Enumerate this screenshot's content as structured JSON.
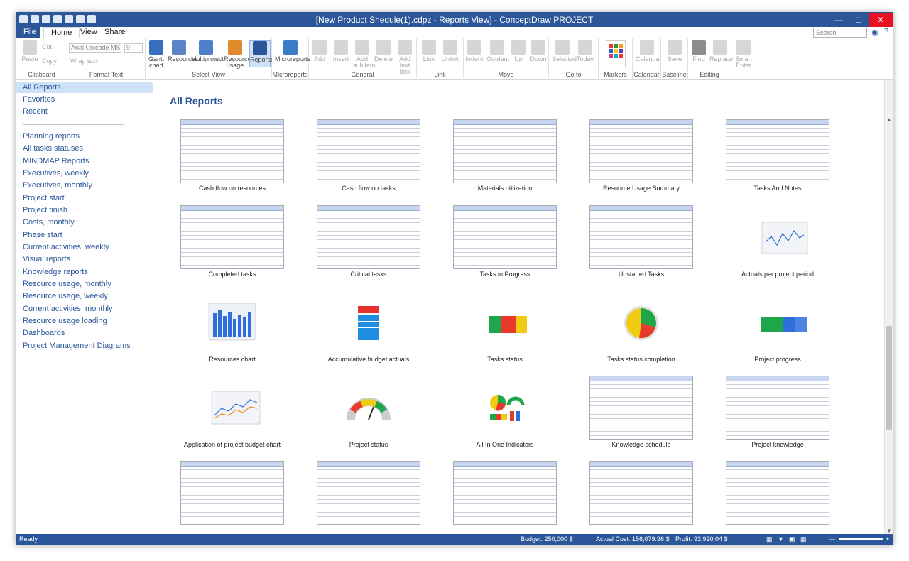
{
  "window": {
    "title": "[New Product Shedule(1).cdpz - Reports View] - ConceptDraw PROJECT"
  },
  "tabs": {
    "file": "File",
    "home": "Home",
    "view": "View",
    "share": "Share"
  },
  "search": {
    "placeholder": "Search"
  },
  "ribbon": {
    "clipboard": {
      "label": "Clipboard",
      "paste": "Paste",
      "cut": "Cut",
      "copy": "Copy"
    },
    "format_text": {
      "label": "Format Text",
      "font": "Arial Unicode MS",
      "size": "9",
      "wrap": "Wrap text"
    },
    "select_view": {
      "label": "Select View",
      "gantt": "Gantt chart",
      "resources": "Resources",
      "multiproject": "Multiproject",
      "resource_usage": "Resource usage",
      "reports": "Reports"
    },
    "microreports": {
      "label": "Microreports",
      "microreports": "Microreports"
    },
    "general": {
      "label": "General",
      "add": "Add",
      "insert": "Insert",
      "add_subitem": "Add subitem",
      "delete": "Delete",
      "add_text_box": "Add text box"
    },
    "link": {
      "label": "Link",
      "link": "Link",
      "unlink": "Unlink"
    },
    "move": {
      "label": "Move",
      "indent": "Indent",
      "outdent": "Outdent",
      "up": "Up",
      "down": "Down"
    },
    "goto": {
      "label": "Go to",
      "selected": "Selected",
      "today": "Today"
    },
    "markers": {
      "label": "Markers",
      "calendar": "Calendar"
    },
    "calendar": {
      "label": "Calendar"
    },
    "baseline": {
      "label": "Baseline",
      "save": "Save"
    },
    "editing": {
      "label": "Editing",
      "find": "Find",
      "replace": "Replace",
      "smart_enter": "Smart Enter"
    }
  },
  "sidebar": {
    "top": [
      "All Reports",
      "Favorites",
      "Recent"
    ],
    "items": [
      "Planning reports",
      "All tasks statuses",
      "MINDMAP Reports",
      "Executives, weekly",
      "Executives, monthly",
      "Project start",
      "Project finish",
      "Costs, monthly",
      "Phase start",
      "Current activities, weekly",
      "Visual reports",
      "Knowledge reports",
      "Resource usage, monthly",
      "Resource usage, weekly",
      "Current activities, monthly",
      "Resource usage loading",
      "Dashboards",
      "Project Management Diagrams"
    ]
  },
  "main": {
    "heading": "All Reports",
    "reports": [
      "Cash flow on resources",
      "Cash flow on tasks",
      "Materials utilization",
      "Resource Usage Summary",
      "Tasks And Notes",
      "Completed tasks",
      "Critical tasks",
      "Tasks in Progress",
      "Unstarted Tasks",
      "Actuals per project period",
      "Resources chart",
      "Accumulative budget actuals",
      "Tasks status",
      "Tasks status completion",
      "Project progress",
      "Application of project budget chart",
      "Project status",
      "All In One Indicators",
      "Knowledge schedule",
      "Project knowledge",
      "",
      "",
      "",
      "",
      ""
    ]
  },
  "status": {
    "ready": "Ready",
    "budget": "Budget: 250,000 $",
    "actual": "Actual Cost: 156,079.96 $",
    "profit": "Profit: 93,920.04 $"
  },
  "colors": {
    "accent": "#2b579a",
    "selected": "#cfe1f7",
    "chart_blue": "#2f6fdc",
    "green": "#1ea64a",
    "yellow": "#f0cc12",
    "red": "#e83a2a"
  }
}
